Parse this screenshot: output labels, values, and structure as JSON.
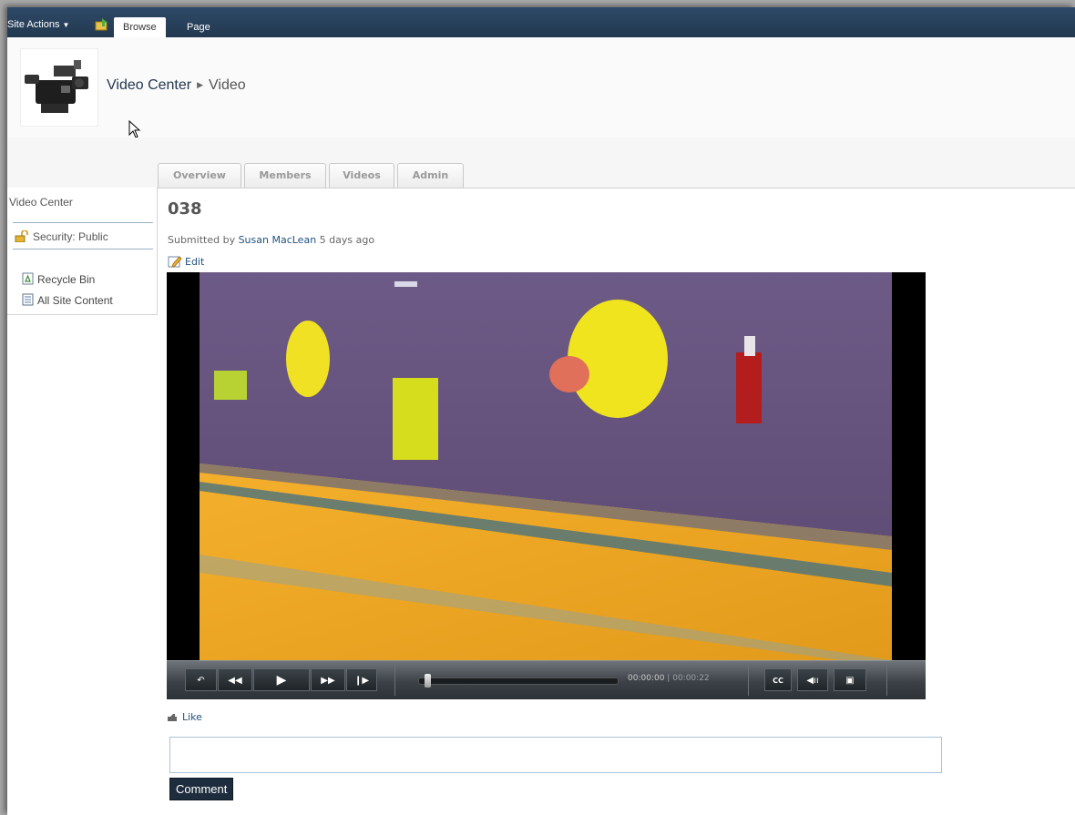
{
  "ribbon": {
    "site_actions": "Site Actions",
    "tabs": [
      "Browse",
      "Page"
    ]
  },
  "header": {
    "site": "Video Center",
    "page": "Video"
  },
  "page_tabs": [
    "Overview",
    "Members",
    "Videos",
    "Admin"
  ],
  "leftnav": {
    "title": "Video Center",
    "security": "Security: Public",
    "recycle_bin": "Recycle Bin",
    "all_site_content": "All Site Content"
  },
  "video": {
    "title": "038",
    "submitted_prefix": "Submitted by",
    "author": "Susan MacLean",
    "age": "5 days ago",
    "edit": "Edit"
  },
  "player": {
    "current_time": "00:00:00",
    "separator": "|",
    "duration": "00:00:22",
    "progress": 0
  },
  "social": {
    "like": "Like",
    "comment_button": "Comment",
    "comment_value": ""
  },
  "colors": {
    "ribbon": "#22384f",
    "link": "#21517f",
    "button": "#1e2d3e"
  }
}
